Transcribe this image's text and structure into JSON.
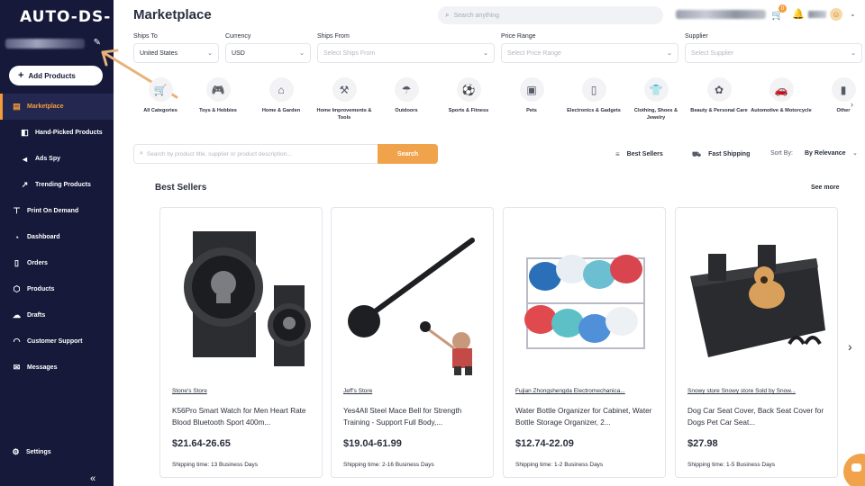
{
  "app": {
    "logo": "AUTO-DS-"
  },
  "sidebar": {
    "add_products": "Add Products",
    "items": [
      {
        "label": "Marketplace",
        "icon": "store-icon",
        "glyph": "▤",
        "active": true,
        "sub": false
      },
      {
        "label": "Hand-Picked Products",
        "icon": "hand-icon",
        "glyph": "◧",
        "active": false,
        "sub": true
      },
      {
        "label": "Ads Spy",
        "icon": "megaphone-icon",
        "glyph": "◄",
        "active": false,
        "sub": true
      },
      {
        "label": "Trending Products",
        "icon": "trend-icon",
        "glyph": "↗",
        "active": false,
        "sub": true
      },
      {
        "label": "Print On Demand",
        "icon": "shirt-icon",
        "glyph": "⊤",
        "active": false,
        "sub": false
      },
      {
        "label": "Dashboard",
        "icon": "gauge-icon",
        "glyph": "◔",
        "active": false,
        "sub": false
      },
      {
        "label": "Orders",
        "icon": "clipboard-icon",
        "glyph": "▯",
        "active": false,
        "sub": false
      },
      {
        "label": "Products",
        "icon": "box-icon",
        "glyph": "⬡",
        "active": false,
        "sub": false
      },
      {
        "label": "Drafts",
        "icon": "cloud-upload-icon",
        "glyph": "☁",
        "active": false,
        "sub": false
      },
      {
        "label": "Customer Support",
        "icon": "headset-icon",
        "glyph": "◠",
        "active": false,
        "sub": false
      },
      {
        "label": "Messages",
        "icon": "mail-icon",
        "glyph": "✉",
        "active": false,
        "sub": false
      }
    ],
    "settings": "Settings",
    "collapse": "«"
  },
  "header": {
    "title": "Marketplace",
    "search_placeholder": "Search anything",
    "cart_count": "0"
  },
  "filters": {
    "ships_to": {
      "label": "Ships To",
      "value": "United States"
    },
    "currency": {
      "label": "Currency",
      "value": "USD"
    },
    "ships_from": {
      "label": "Ships From",
      "placeholder": "Select Ships From"
    },
    "price_range": {
      "label": "Price Range",
      "placeholder": "Select Price Range"
    },
    "supplier": {
      "label": "Supplier",
      "placeholder": "Select Supplier"
    }
  },
  "categories": [
    {
      "label": "All Categories",
      "icon": "cart-icon",
      "glyph": "🛒"
    },
    {
      "label": "Toys & Hobbies",
      "icon": "gamepad-icon",
      "glyph": "🎮"
    },
    {
      "label": "Home & Garden",
      "icon": "house-icon",
      "glyph": "⌂"
    },
    {
      "label": "Home Improvements & Tools",
      "icon": "toolbox-icon",
      "glyph": "⚒"
    },
    {
      "label": "Outdoors",
      "icon": "umbrella-icon",
      "glyph": "☂"
    },
    {
      "label": "Sports & Fitness",
      "icon": "ball-icon",
      "glyph": "⚽"
    },
    {
      "label": "Pets",
      "icon": "pet-food-icon",
      "glyph": "▣"
    },
    {
      "label": "Electronics & Gadgets",
      "icon": "phone-icon",
      "glyph": "▯"
    },
    {
      "label": "Clothing, Shoes & Jewelry",
      "icon": "shirt-icon",
      "glyph": "👕"
    },
    {
      "label": "Beauty & Personal Care",
      "icon": "cosmetics-icon",
      "glyph": "✿"
    },
    {
      "label": "Automotive & Motorcycle",
      "icon": "car-icon",
      "glyph": "🚗"
    },
    {
      "label": "Other",
      "icon": "other-icon",
      "glyph": "▮"
    }
  ],
  "product_search": {
    "placeholder": "Search by product title, supplier or product description...",
    "button": "Search",
    "best_sellers": "Best Sellers",
    "fast_shipping": "Fast Shipping",
    "sort_label": "Sort By:",
    "sort_value": "By Relevance"
  },
  "section": {
    "title": "Best Sellers",
    "see_more": "See more"
  },
  "products": [
    {
      "store": "Stone's Store",
      "title": "K56Pro Smart Watch for Men Heart Rate Blood Bluetooth Sport 400m...",
      "price": "$21.64-26.65",
      "shipping": "Shipping time: 13 Business Days",
      "image": "smartwatch-image"
    },
    {
      "store": "Jeff's Store",
      "title": "Yes4All Steel Mace Bell for Strength Training - Support Full Body,...",
      "price": "$19.04-61.99",
      "shipping": "Shipping time: 2-16 Business Days",
      "image": "mace-bell-image"
    },
    {
      "store": "Fujian Zhongshengda Electromechanica...",
      "title": "Water Bottle Organizer for Cabinet, Water Bottle Storage Organizer, 2...",
      "price": "$12.74-22.09",
      "shipping": "Shipping time: 1-2 Business Days",
      "image": "bottle-organizer-image"
    },
    {
      "store": "Snowy store Snowy store Sold by Snow...",
      "title": "Dog Car Seat Cover, Back Seat Cover for Dogs Pet Car Seat...",
      "price": "$27.98",
      "shipping": "Shipping time: 1-5 Business Days",
      "image": "dog-seat-cover-image"
    }
  ]
}
